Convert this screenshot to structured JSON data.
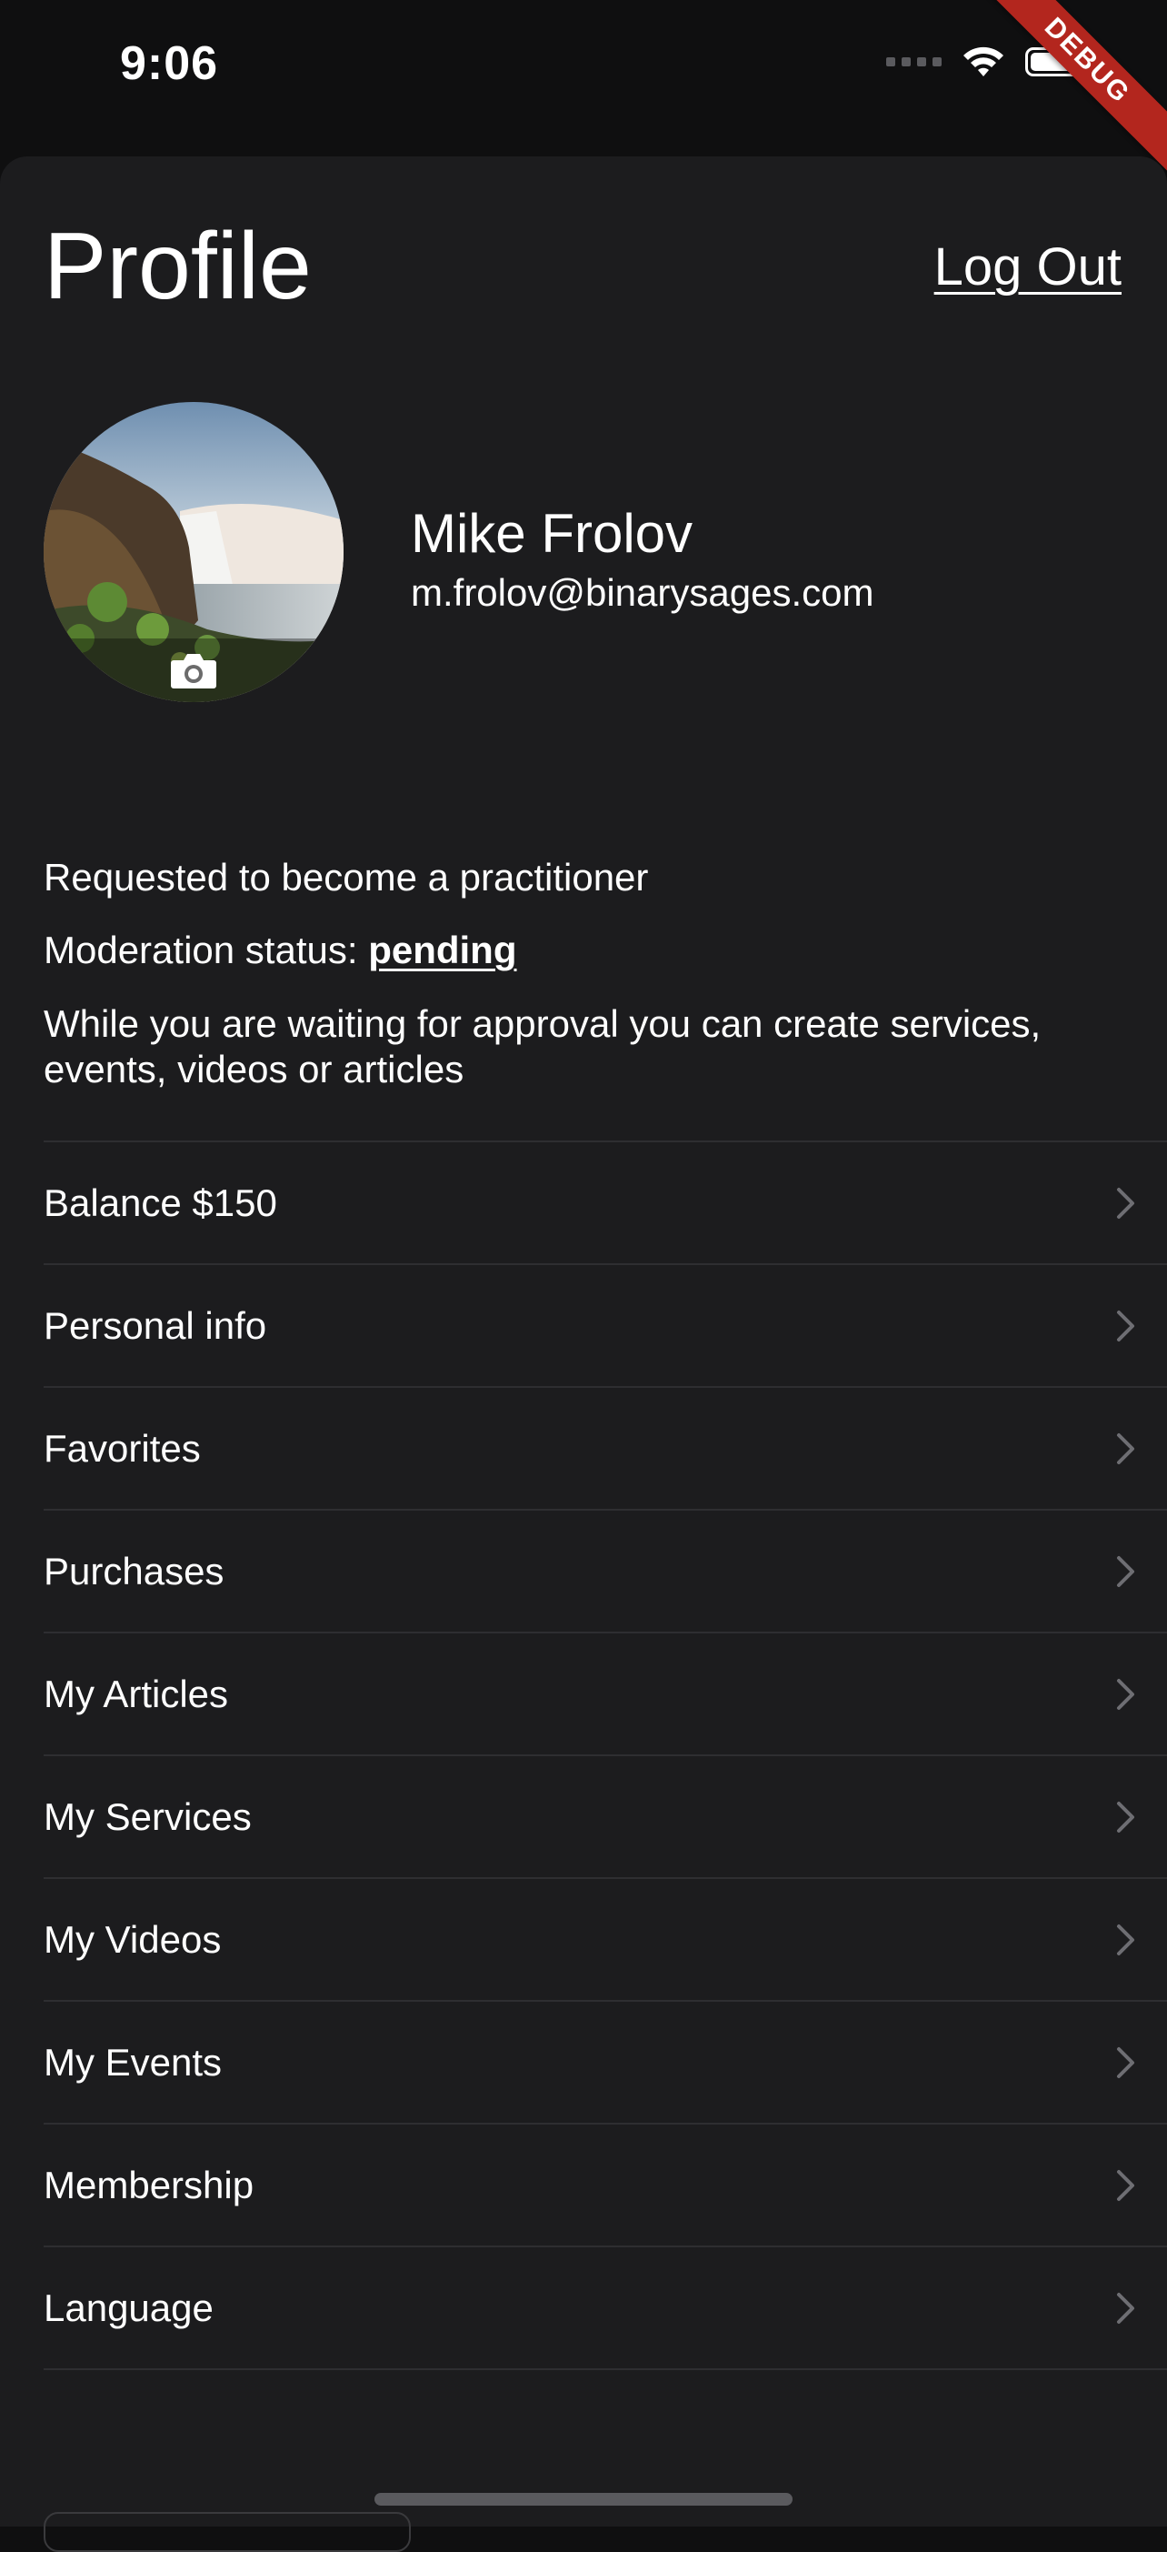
{
  "status_bar": {
    "time": "9:06",
    "icons": [
      "signal-icon",
      "wifi-icon",
      "battery-icon"
    ]
  },
  "debug_banner": "DEBUG",
  "header": {
    "title": "Profile",
    "logout_label": "Log Out"
  },
  "profile": {
    "name": "Mike Frolov",
    "email": "m.frolov@binarysages.com",
    "avatar_icon": "camera-icon"
  },
  "moderation": {
    "requested_text": "Requested to become a practitioner",
    "status_label": "Moderation status:",
    "status_value": "pending",
    "description": "While you are waiting for approval you can create services, events, videos or articles"
  },
  "menu": {
    "items": [
      {
        "label": "Balance $150"
      },
      {
        "label": "Personal info"
      },
      {
        "label": "Favorites"
      },
      {
        "label": "Purchases"
      },
      {
        "label": "My Articles"
      },
      {
        "label": "My Services"
      },
      {
        "label": "My Videos"
      },
      {
        "label": "My Events"
      },
      {
        "label": "Membership"
      },
      {
        "label": "Language"
      }
    ],
    "chevron_icon": "chevron-right-icon"
  },
  "colors": {
    "background": "#1c1c1e",
    "status_bar_bg": "#0f0f10",
    "divider": "#2e2e31",
    "chevron": "#6e6e73",
    "debug": "#b3261e"
  }
}
